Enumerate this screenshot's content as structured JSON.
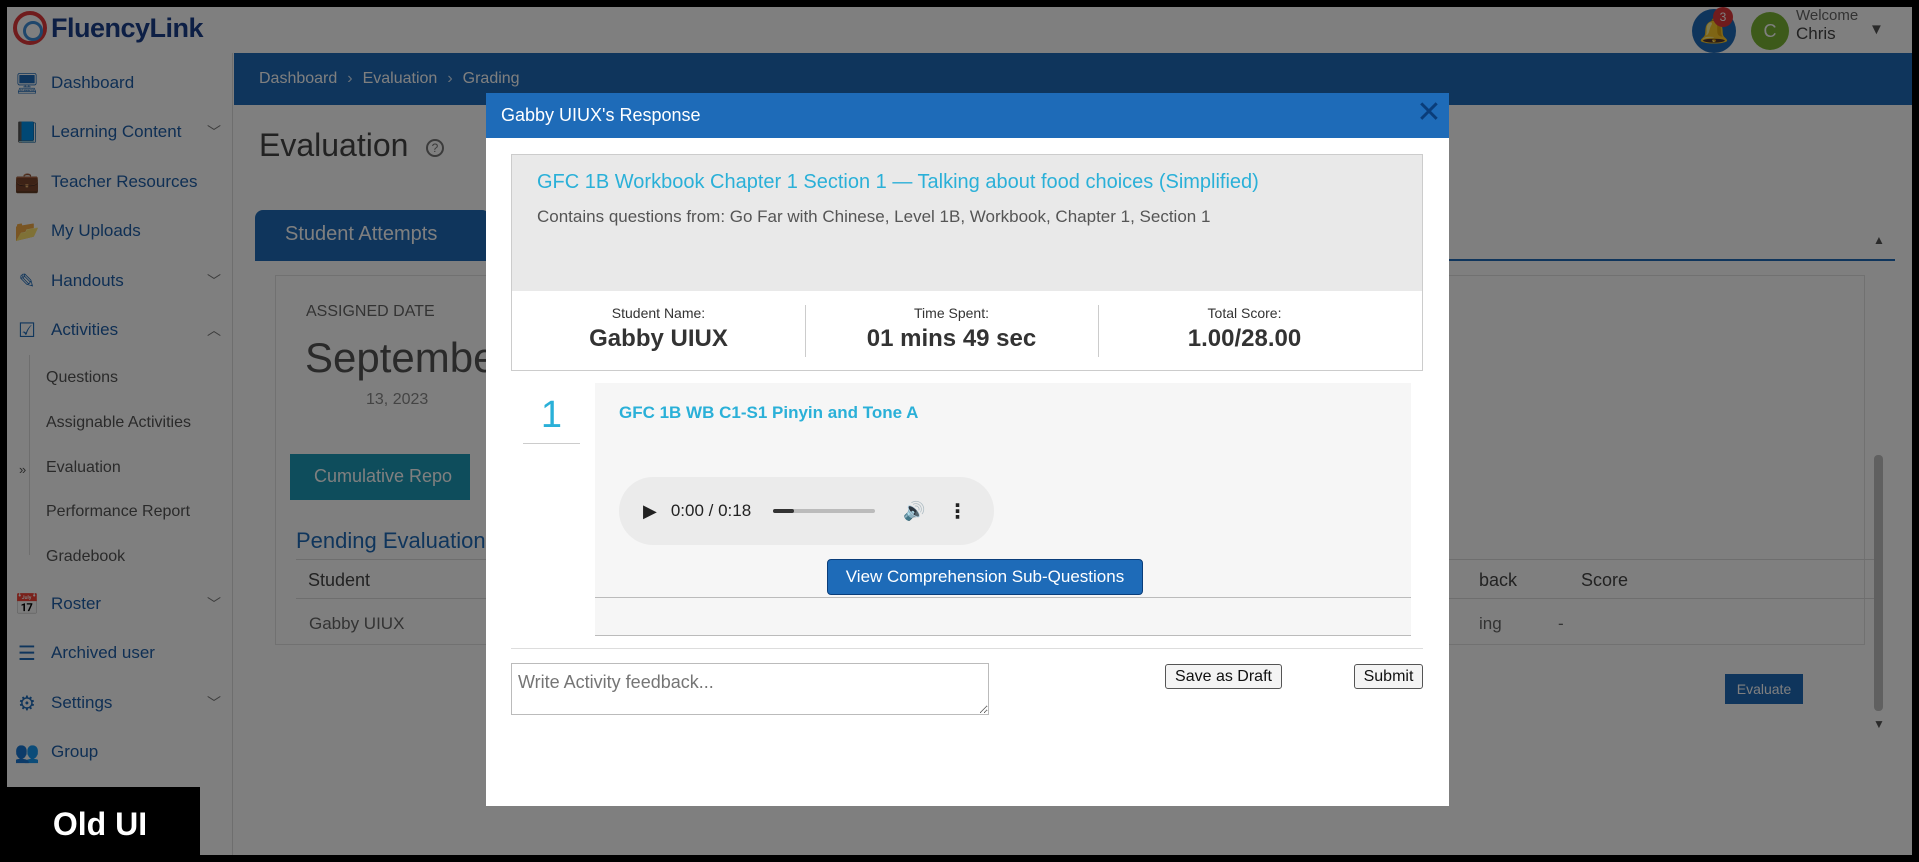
{
  "app": {
    "logo_text": "FluencyLink"
  },
  "header": {
    "notification_count": "3",
    "avatar_initial": "C",
    "welcome": "Welcome",
    "user_name": "Chris"
  },
  "sidebar": {
    "items": [
      {
        "label": "Dashboard",
        "icon": "monitor-icon"
      },
      {
        "label": "Learning Content",
        "icon": "book-icon"
      },
      {
        "label": "Teacher Resources",
        "icon": "briefcase-icon"
      },
      {
        "label": "My Uploads",
        "icon": "folder-icon"
      },
      {
        "label": "Handouts",
        "icon": "pencil-icon"
      },
      {
        "label": "Activities",
        "icon": "checkbox-icon"
      },
      {
        "label": "Roster",
        "icon": "calendar-icon"
      },
      {
        "label": "Archived user",
        "icon": "list-icon"
      },
      {
        "label": "Settings",
        "icon": "gear-icon"
      },
      {
        "label": "Group",
        "icon": "users-icon"
      }
    ],
    "activities_sub": [
      "Questions",
      "Assignable Activities",
      "Evaluation",
      "Performance Report",
      "Gradebook"
    ]
  },
  "breadcrumb": [
    "Dashboard",
    "Evaluation",
    "Grading"
  ],
  "page": {
    "title": "Evaluation",
    "tab": "Student Attempts",
    "assigned_label": "ASSIGNED DATE",
    "big_date": "Septembe",
    "small_date": "13, 2023",
    "cumulative_btn": "Cumulative Repo",
    "pending_title": "Pending Evaluation",
    "table_headers": [
      "Student",
      "back",
      "Score"
    ],
    "row": {
      "student": "Gabby UIUX",
      "feedback": "ing",
      "score": "-",
      "action": "Evaluate"
    }
  },
  "badge": "Old UI",
  "modal": {
    "title": "Gabby UIUX's Response",
    "activity_title": "GFC 1B Workbook Chapter 1 Section 1 — Talking about food choices (Simplified)",
    "activity_sub": "Contains questions from: Go Far with Chinese, Level 1B, Workbook, Chapter 1, Section 1",
    "stats": [
      {
        "label": "Student Name:",
        "value": "Gabby UIUX"
      },
      {
        "label": "Time Spent:",
        "value": "01 mins 49 sec"
      },
      {
        "label": "Total Score:",
        "value": "1.00/28.00"
      }
    ],
    "question": {
      "number": "1",
      "title": "GFC 1B WB C1-S1 Pinyin and Tone A",
      "audio_time": "0:00 / 0:18",
      "audio_progress": 0.2,
      "subq_btn": "View Comprehension Sub-Questions"
    },
    "feedback_placeholder": "Write Activity feedback...",
    "save_draft": "Save as Draft",
    "submit": "Submit"
  }
}
